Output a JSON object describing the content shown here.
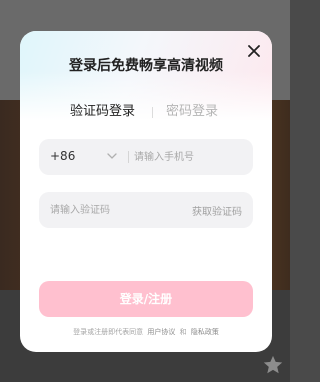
{
  "modal": {
    "title": "登录后免费畅享高清视频",
    "tabs": [
      {
        "label": "验证码登录",
        "active": true
      },
      {
        "label": "密码登录",
        "active": false
      }
    ],
    "phone": {
      "country_code": "+86",
      "placeholder": "请输入手机号",
      "value": ""
    },
    "code": {
      "placeholder": "请输入验证码",
      "value": "",
      "get_code_label": "获取验证码"
    },
    "submit_label": "登录/注册",
    "agreement": {
      "prefix": "登录或注册即代表同意",
      "user_agreement": "用户协议",
      "and": "和",
      "privacy_policy": "隐私政策"
    }
  },
  "colors": {
    "accent": "#ffc0cf",
    "field_bg": "#f2f2f4",
    "overlay": "#4a4a4a"
  }
}
